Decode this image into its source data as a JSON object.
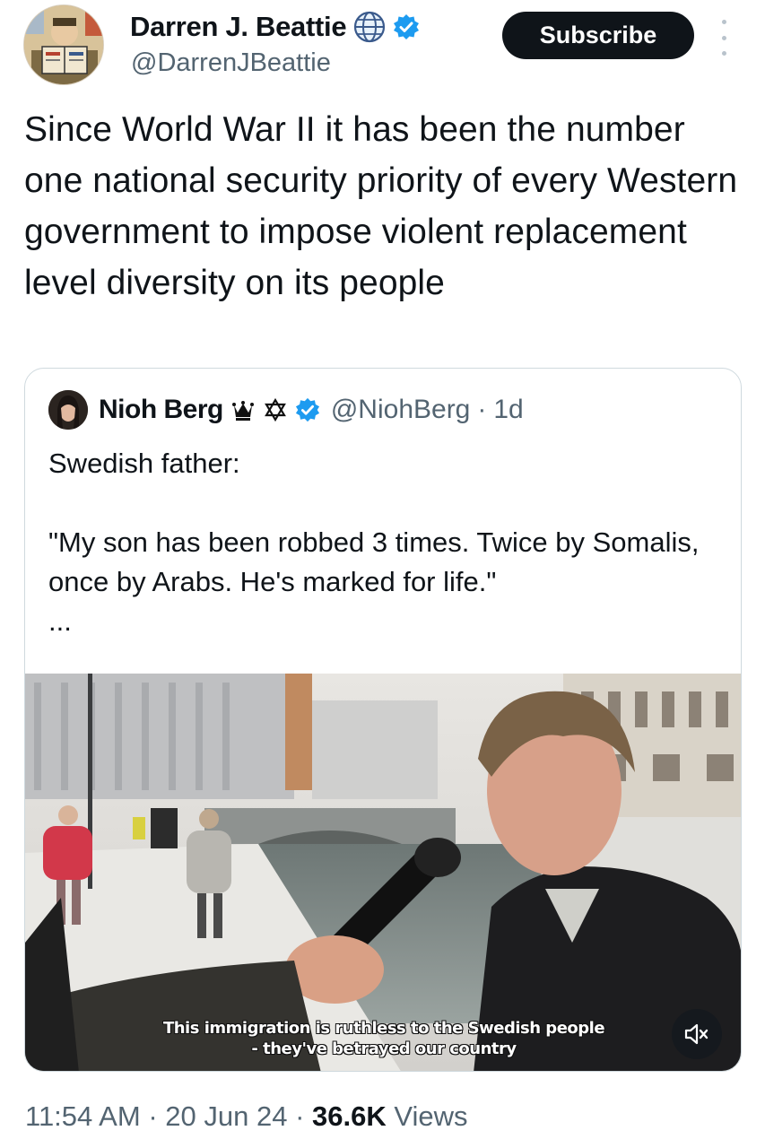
{
  "author": {
    "display_name": "Darren J. Beattie",
    "handle": "@DarrenJBeattie",
    "avatar_icon": "author-avatar-comic-illustration",
    "badges": [
      "globe-icon",
      "verified-badge-icon"
    ]
  },
  "subscribe_label": "Subscribe",
  "more_icon": "vertical-dots-icon",
  "tweet_text": "Since World War II it has been the number one national security priority of every Western government to impose violent replacement level diversity on its people",
  "quoted_tweet": {
    "display_name": "Nioh Berg",
    "handle": "@NiohBerg",
    "separator": "·",
    "time": "1d",
    "badges": [
      "crown-icon",
      "star-of-david-icon",
      "verified-badge-icon"
    ],
    "text_line1": "Swedish father:",
    "text_line2": "\"My son has been robbed 3 times. Twice by Somalis, once by Arabs. He's marked for life.\"",
    "truncation": "...",
    "video": {
      "subtitle_line1": "This immigration is ruthless to the Swedish people",
      "subtitle_line2": "- they've betrayed our country",
      "mute_icon": "speaker-muted-icon"
    }
  },
  "footer": {
    "time": "11:54 AM",
    "sep1": "·",
    "date": "20 Jun 24",
    "sep2": "·",
    "views_count": "36.6K",
    "views_label": "Views"
  },
  "colors": {
    "text_primary": "#0f1419",
    "text_secondary": "#536471",
    "verified_blue": "#1d9bf0",
    "border": "#cfd9de",
    "subscribe_bg": "#0f1419"
  }
}
